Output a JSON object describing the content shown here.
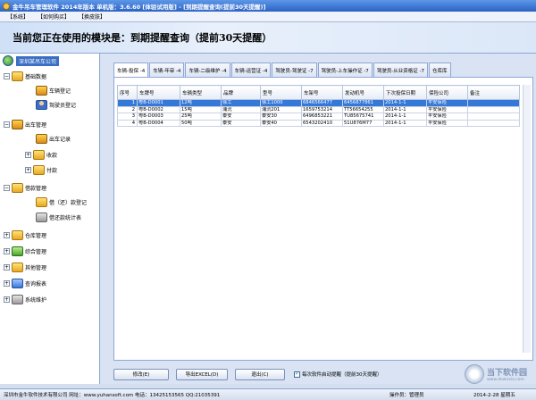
{
  "window": {
    "title": "金牛吊车管理软件 2014年版本 单机版：3.6.60 [体验试用版] - [到期提醒查询(提前30天提醒)]"
  },
  "menu": [
    "【系统】",
    "【如何购买】",
    "【换皮肤】"
  ],
  "banner": {
    "text": "当前您正在使用的模块是：到期提醒查询（提前30天提醒）"
  },
  "sidebar": {
    "root": "深圳某吊车公司",
    "items": [
      {
        "label": "基础数据",
        "level": 0,
        "expander": "−"
      },
      {
        "label": "车辆登记",
        "level": 1
      },
      {
        "label": "驾驶员登记",
        "level": 1
      },
      {
        "label": "出车管理",
        "level": 0,
        "expander": "−"
      },
      {
        "label": "出车记录",
        "level": 1
      },
      {
        "label": "收款",
        "level": 1,
        "expander": "+"
      },
      {
        "label": "付款",
        "level": 1,
        "expander": "+"
      },
      {
        "label": "借款管理",
        "level": 0,
        "expander": "−"
      },
      {
        "label": "借（还）款登记",
        "level": 1
      },
      {
        "label": "借还款统计表",
        "level": 1
      },
      {
        "label": "仓库管理",
        "level": 0,
        "expander": "+"
      },
      {
        "label": "综合管理",
        "level": 0,
        "expander": "+"
      },
      {
        "label": "其他管理",
        "level": 0,
        "expander": "+"
      },
      {
        "label": "查询报表",
        "level": 0,
        "expander": "+"
      },
      {
        "label": "系统维护",
        "level": 0,
        "expander": "+"
      }
    ]
  },
  "tabs": [
    {
      "label": "车辆-投保 -4",
      "active": true
    },
    {
      "label": "车辆-年审 -4"
    },
    {
      "label": "车辆-二级维护 -4"
    },
    {
      "label": "车辆-运营证 -4"
    },
    {
      "label": "驾驶员-驾驶证 -7"
    },
    {
      "label": "驾驶员-上车操作证 -7"
    },
    {
      "label": "驾驶员-从业资格证 -7"
    },
    {
      "label": "仓库库"
    }
  ],
  "table": {
    "columns": [
      "序号",
      "车牌号",
      "车辆类型",
      "品牌",
      "型号",
      "车架号",
      "发动机号",
      "下次投保日期",
      "保险公司",
      "备注"
    ],
    "rows": [
      [
        "1",
        "粤B-D0001",
        "12吨",
        "徐工",
        "徐工1000",
        "6846566477",
        "6456877861",
        "2014-1-1",
        "平安保险",
        ""
      ],
      [
        "2",
        "粤B-D0002",
        "15吨",
        "浦沅",
        "浦沅201",
        "1659753214",
        "TT56654255",
        "2014-1-1",
        "平安保险",
        ""
      ],
      [
        "3",
        "粤B-D0003",
        "25吨",
        "泰安",
        "泰安30",
        "6496853221",
        "TU85675741",
        "2014-1-1",
        "平安保险",
        ""
      ],
      [
        "4",
        "粤B-D0004",
        "50吨",
        "泰安",
        "泰安40",
        "6543202410",
        "51U876M77",
        "2014-1-1",
        "平安保险",
        ""
      ]
    ],
    "selected_row": 0
  },
  "buttons": {
    "modify": "修改(E)",
    "export": "导出EXCEL(D)",
    "exit": "退出(C)"
  },
  "checkbox": {
    "label": "每次软件启动提醒（提前30天提醒）",
    "checked": true
  },
  "status": {
    "company": "深圳市金牛软件技术有限公司  网址：www.yuhansoft.com  电话：13425153565 QQ:21035391",
    "operator": "操作员：管理员",
    "date": "2014-2-28  星期五"
  },
  "watermark": {
    "text": "当下软件园",
    "sub": "www.downxia.com"
  }
}
